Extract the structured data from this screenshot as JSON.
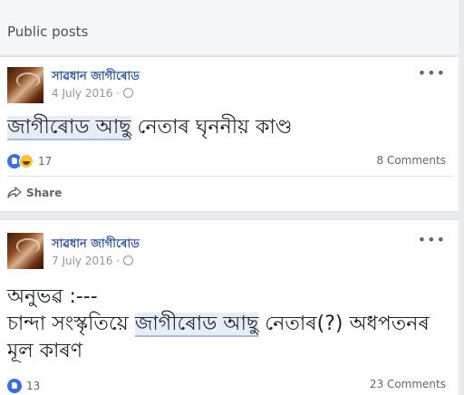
{
  "section": {
    "title": "Public posts"
  },
  "posts": [
    {
      "author": "সাৱধান জাগীৰোড",
      "date": "4 July 2016 ·",
      "text_before": "",
      "text_highlight": "জাগীৰোড আছু",
      "text_after": " নেতাৰ ঘৃননীয় কাণ্ড",
      "reaction_count": "17",
      "comments": "8 Comments",
      "share_label": "Share"
    },
    {
      "author": "সাৱধান জাগীৰোড",
      "date": "7 July 2016 ·",
      "line1": "অনুভৱ :---",
      "text_before": "চান্দা সংস্কৃতিয়ে ",
      "text_highlight": "জাগীৰোড আছু",
      "text_after": " নেতাৰ(?) অধপতনৰ",
      "line3": "মূল কাৰণ",
      "reaction_count": "13",
      "comments": "23 Comments"
    }
  ]
}
